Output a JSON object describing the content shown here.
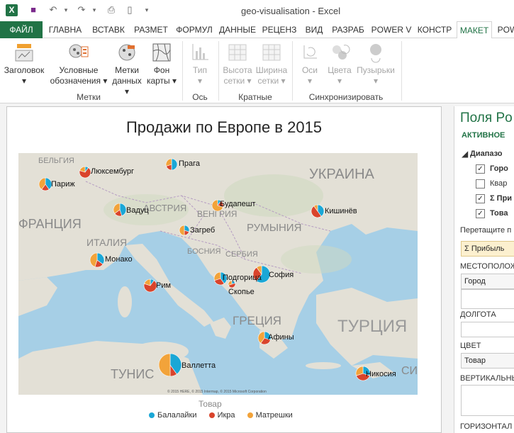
{
  "window": {
    "title": "geo-visualisation - Excel",
    "app_icon_letter": "X"
  },
  "tabs": [
    "ФАЙЛ",
    "ГЛАВНА",
    "ВСТАВК",
    "РАЗМЕТ",
    "ФОРМУЛ",
    "ДАННЫЕ",
    "РЕЦЕНЗ",
    "ВИД",
    "РАЗРАБ",
    "POWER V",
    "КОНСТР",
    "МАКЕТ",
    "POW"
  ],
  "active_tab": "МАКЕТ",
  "ribbon": {
    "buttons": [
      {
        "line1": "Заголовок",
        "line2": "▾"
      },
      {
        "line1": "Условные",
        "line2": "обозначения ▾"
      },
      {
        "line1": "Метки",
        "line2": "данных ▾"
      },
      {
        "line1": "Фон",
        "line2": "карты ▾"
      },
      {
        "line1": "Тип",
        "line2": "▾"
      },
      {
        "line1": "Высота",
        "line2": "сетки ▾"
      },
      {
        "line1": "Ширина",
        "line2": "сетки ▾"
      },
      {
        "line1": "Оси",
        "line2": "▾"
      },
      {
        "line1": "Цвета",
        "line2": "▾"
      },
      {
        "line1": "Пузырьки",
        "line2": "▾"
      }
    ],
    "groups": [
      "Метки",
      "Ось",
      "Кратные",
      "Синхронизировать"
    ]
  },
  "chart_data": {
    "type": "map",
    "title": "Продажи по Европе в 2015",
    "legend_title": "Товар",
    "series": [
      {
        "name": "Балалайки",
        "color": "#1aa7d6"
      },
      {
        "name": "Икра",
        "color": "#d9442c"
      },
      {
        "name": "Матрешки",
        "color": "#f2a33a"
      }
    ],
    "cities": [
      "Прага",
      "Люксембург",
      "Париж",
      "Вадуц",
      "Будапешт",
      "Кишинёв",
      "Загреб",
      "Монако",
      "Рим",
      "Подгорица",
      "София",
      "Скопье",
      "Афины",
      "Валлетта",
      "Никосия"
    ],
    "map_labels": [
      "УКРАИНА",
      "ФРАНЦИЯ",
      "АВСТРИЯ",
      "ВЕНГРИЯ",
      "РУМЫНИЯ",
      "ИТАЛИЯ",
      "БОСНИЯ",
      "СЕРБИЯ",
      "ГРЕЦИЯ",
      "ТУРЦИЯ",
      "ТУНИС",
      "БЕЛЬГИЯ",
      "СИРИ"
    ],
    "attribution": "© 2015 HERE, © 2015 Intermap, © 2015 Microsoft Corporation"
  },
  "panel": {
    "title": "Поля Po",
    "active_label": "АКТИВНОЕ",
    "range_label": "Диапазо",
    "fields": [
      {
        "label": "Горо",
        "checked": true,
        "bold": true
      },
      {
        "label": "Квар",
        "checked": false,
        "bold": false
      },
      {
        "label": "Σ При",
        "checked": true,
        "bold": true
      },
      {
        "label": "Това",
        "checked": true,
        "bold": true
      }
    ],
    "drag_hint": "Перетащите п",
    "value_field": "Σ Прибыль",
    "location_label": "МЕСТОПОЛОЖ",
    "location_value": "Город",
    "longitude_label": "ДОЛГОТА",
    "color_label": "ЦВЕТ",
    "color_value": "Товар",
    "vertical_label": "ВЕРТИКАЛЬНЫ",
    "horizontal_label": "ГОРИЗОНТАЛ"
  }
}
